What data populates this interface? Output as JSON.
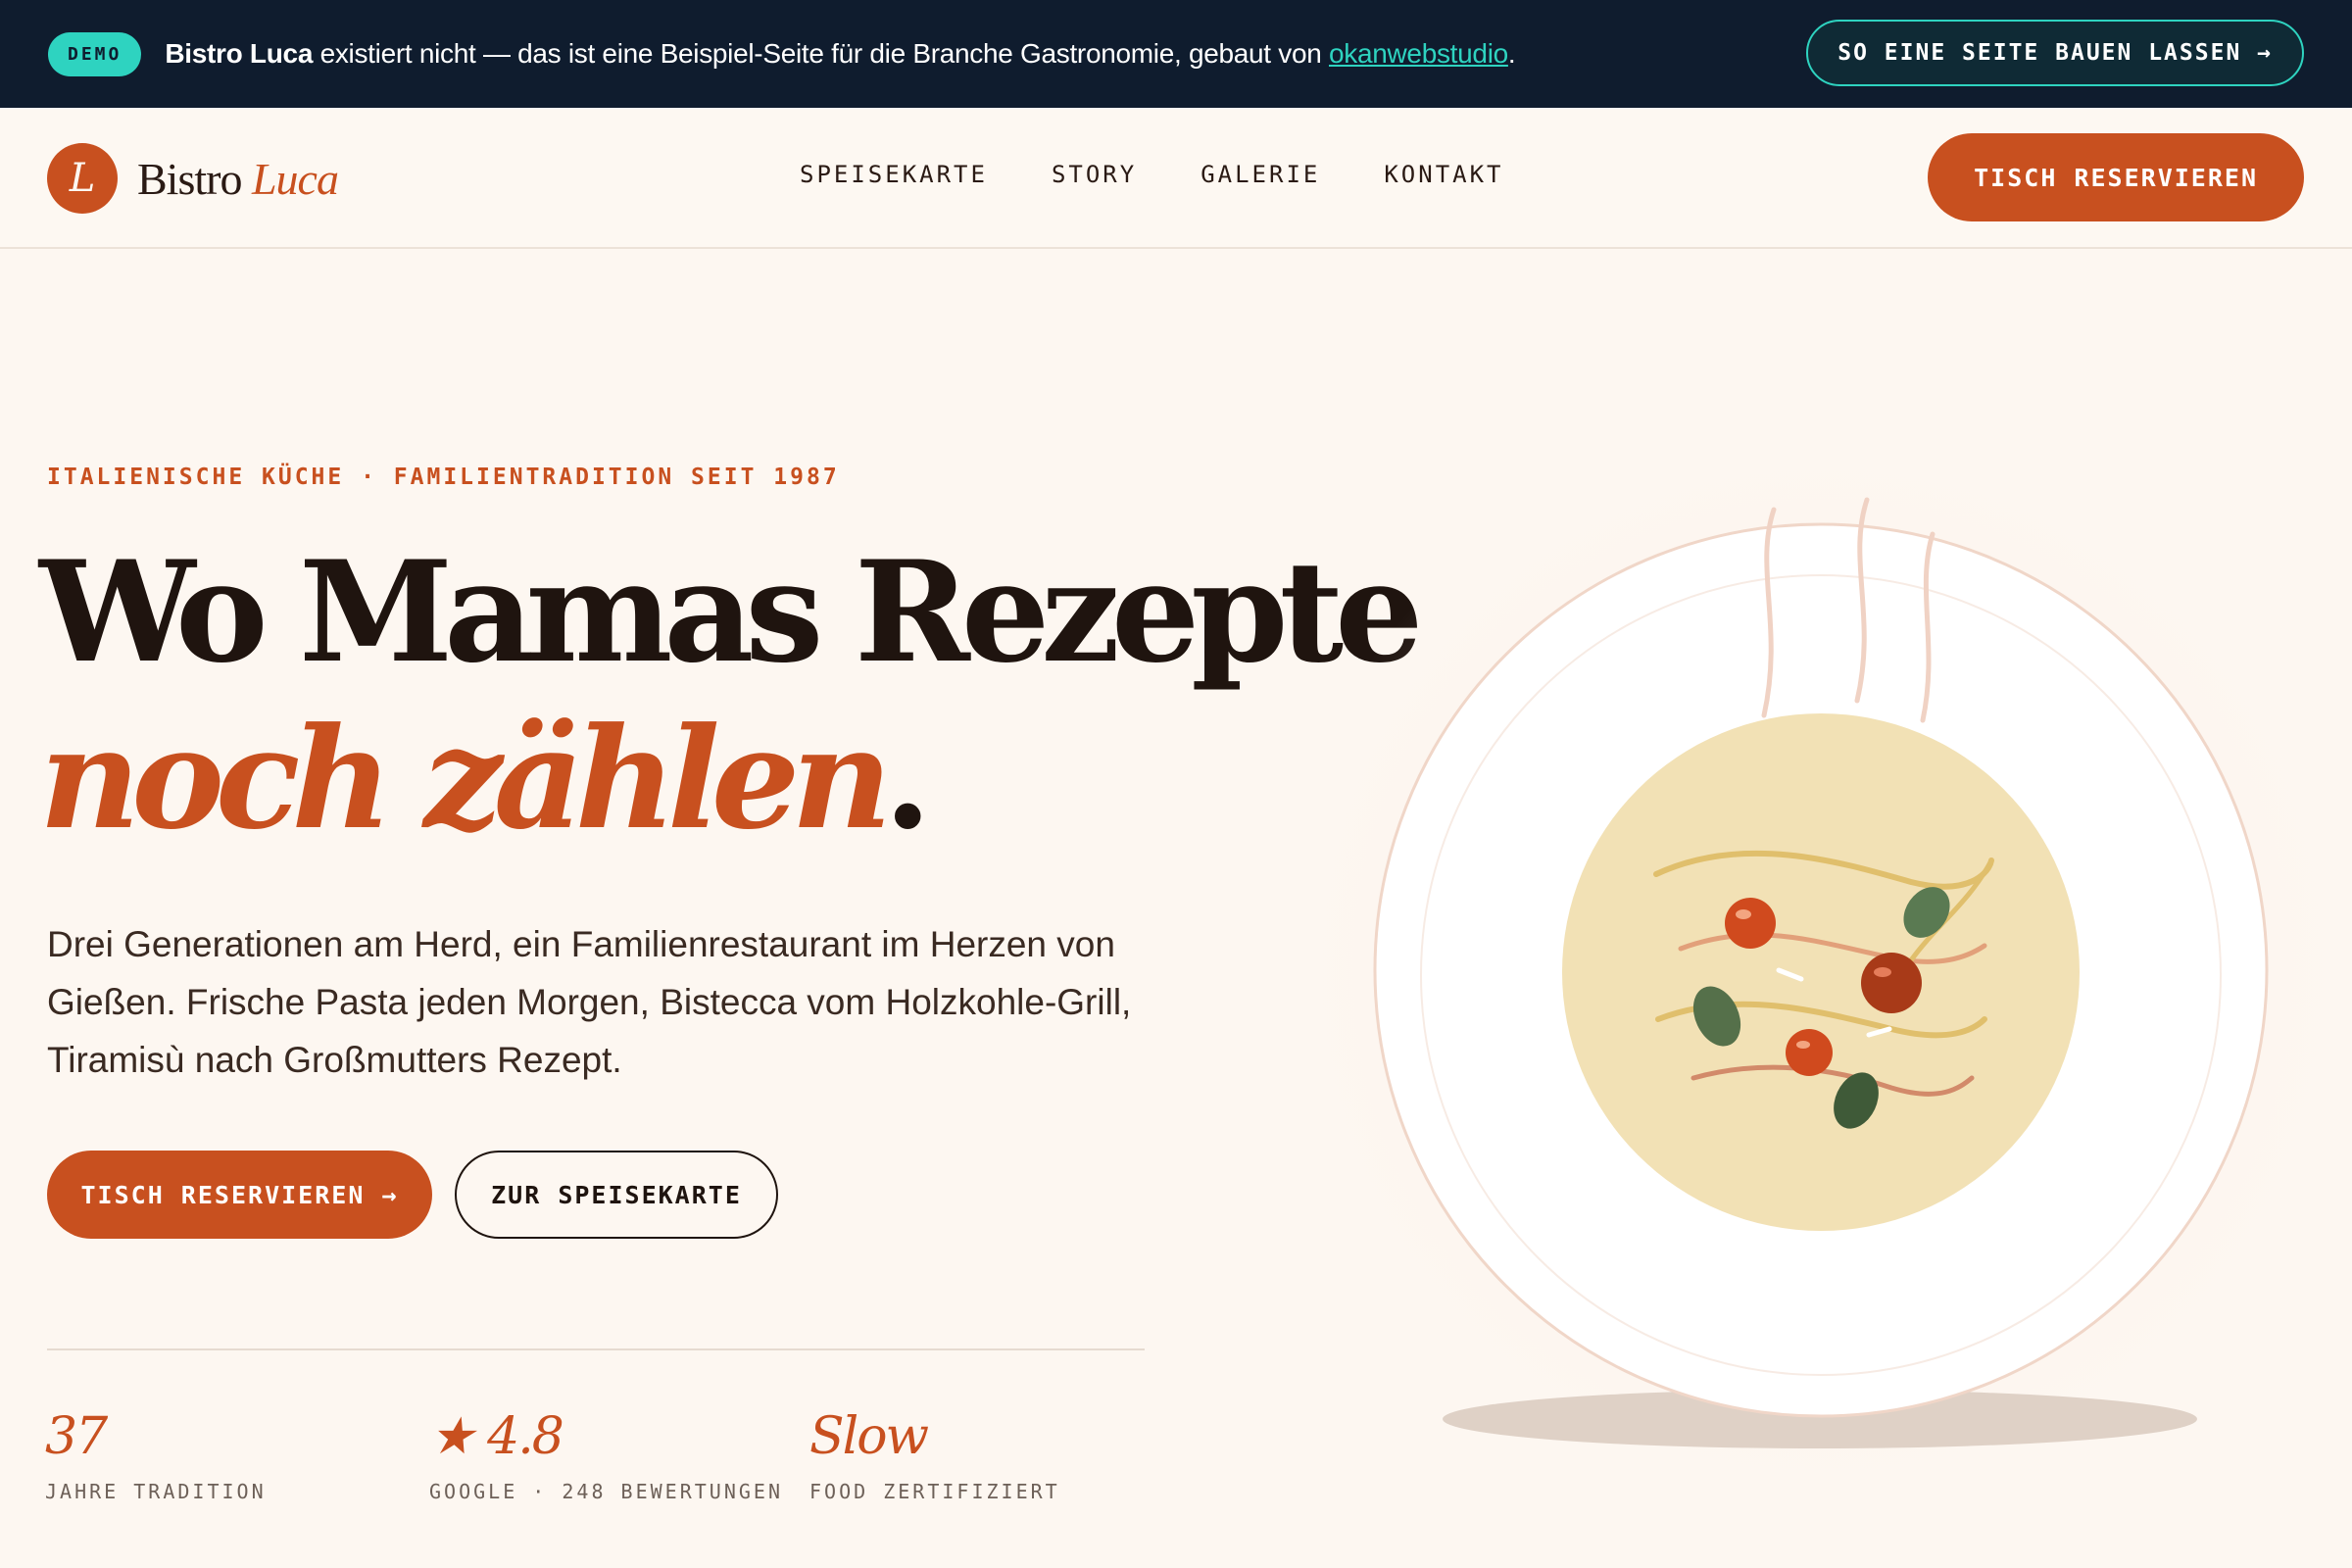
{
  "demo": {
    "badge": "DEMO",
    "brand": "Bistro Luca",
    "text": " existiert nicht — das ist eine Beispiel-Seite für die Branche Gastronomie, gebaut von ",
    "link": "okanwebstudio",
    "period": ".",
    "cta": "SO EINE SEITE BAUEN LASSEN →"
  },
  "nav": {
    "logo_mark": "L",
    "logo_main": "Bistro ",
    "logo_accent": "Luca",
    "links": [
      "SPEISEKARTE",
      "STORY",
      "GALERIE",
      "KONTAKT"
    ],
    "cta": "TISCH RESERVIEREN"
  },
  "hero": {
    "eyebrow": "ITALIENISCHE KÜCHE · FAMILIENTRADITION SEIT 1987",
    "headline_line1": "Wo Mamas Rezepte",
    "headline_line2": "noch zählen",
    "headline_dot": ".",
    "lead": "Drei Generationen am Herd, ein Familienrestaurant im Herzen von Gießen. Frische Pasta jeden Morgen, Bistecca vom Holzkohle-Grill, Tiramisù nach Großmutters Rezept.",
    "primary_cta": "TISCH RESERVIEREN →",
    "secondary_cta": "ZUR SPEISEKARTE"
  },
  "stats": [
    {
      "value": "37",
      "label": "JAHRE TRADITION"
    },
    {
      "value": "★ 4.8",
      "label": "GOOGLE · 248 BEWERTUNGEN"
    },
    {
      "value": "Slow",
      "label": "FOOD ZERTIFIZIERT"
    }
  ],
  "colors": {
    "accent": "#c8501f",
    "demo_bar": "#0f1c2e",
    "demo_accent": "#2ed3c0",
    "background": "#fdf7f1"
  },
  "illustration": {
    "icon": "pasta-plate-illustration"
  }
}
